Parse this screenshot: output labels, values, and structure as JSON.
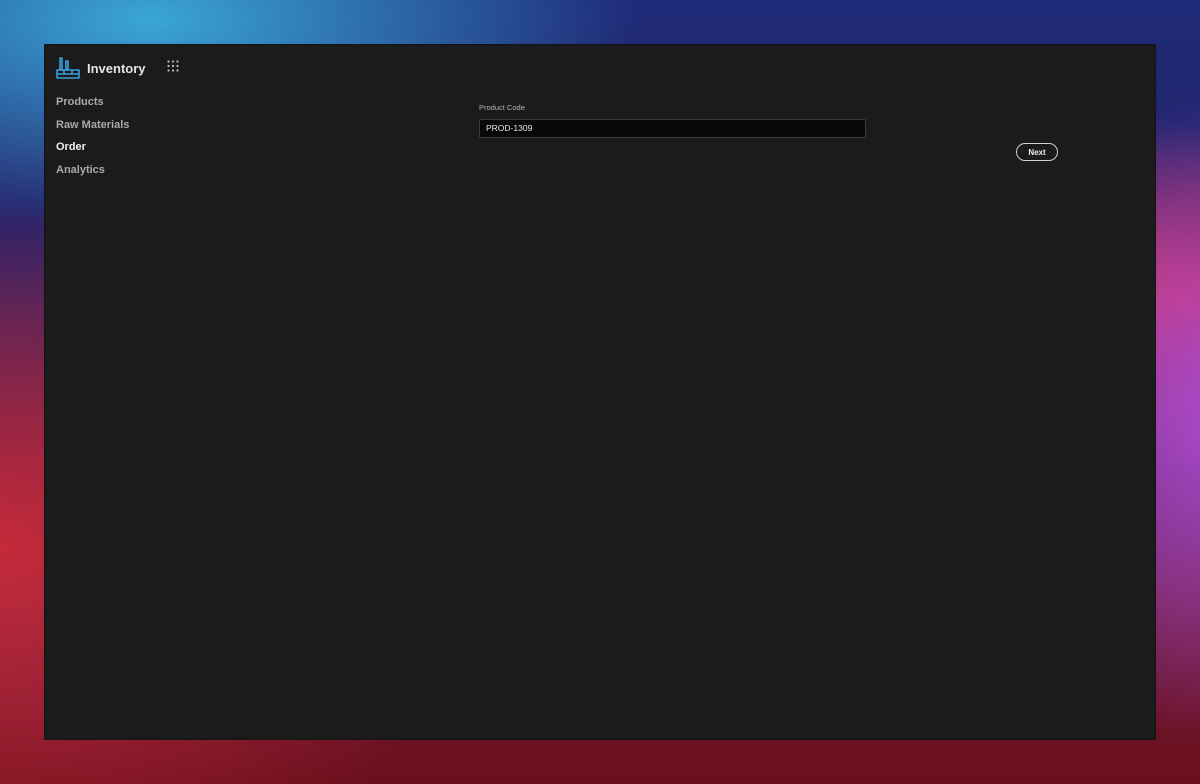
{
  "app": {
    "title": "Inventory",
    "logo_icon": "factory-icon",
    "apps_icon": "grid-dots-icon",
    "accent_color": "#3aa0e0"
  },
  "sidebar": {
    "items": [
      {
        "label": "Products",
        "active": false
      },
      {
        "label": "Raw Materials",
        "active": false
      },
      {
        "label": "Order",
        "active": true
      },
      {
        "label": "Analytics",
        "active": false
      }
    ]
  },
  "form": {
    "product_code_label": "Product Code",
    "product_code_value": "PROD-1309",
    "next_label": "Next"
  }
}
